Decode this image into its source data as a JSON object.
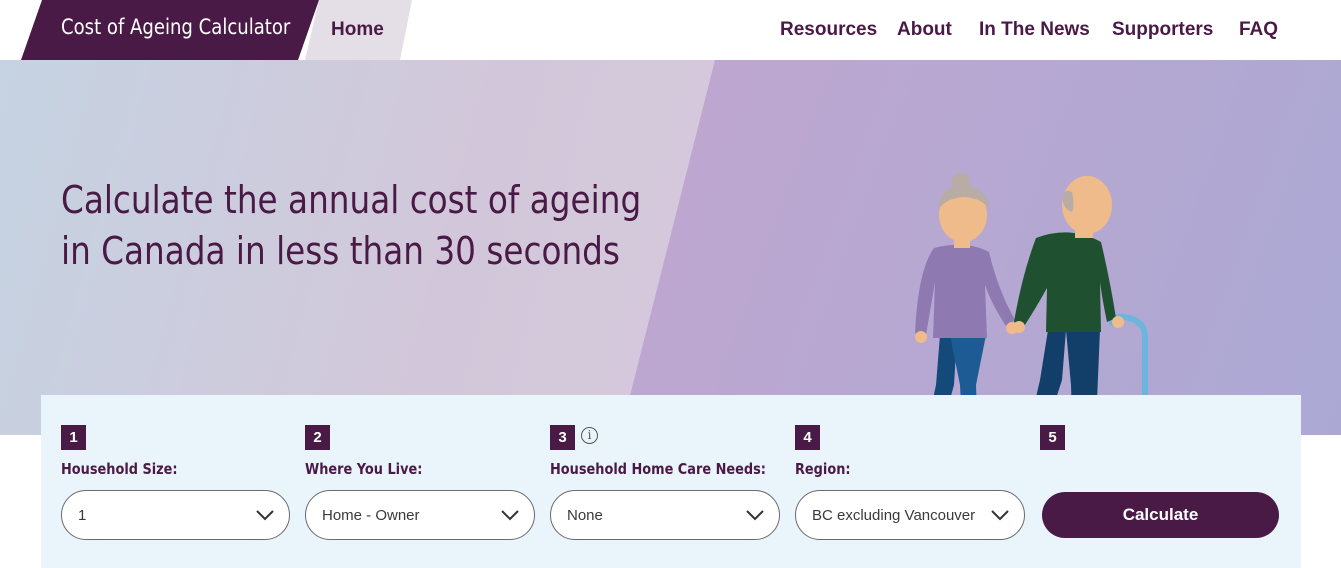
{
  "brand": {
    "title": "Cost of Ageing Calculator"
  },
  "nav": {
    "home": "Home",
    "links": [
      "Resources",
      "About",
      "In The News",
      "Supporters",
      "FAQ"
    ]
  },
  "hero": {
    "headline_line1": "Calculate the annual cost of ageing",
    "headline_line2": "in Canada in less than 30 seconds"
  },
  "form": {
    "steps": [
      {
        "number": "1",
        "label": "Household Size:",
        "value": "1"
      },
      {
        "number": "2",
        "label": "Where You Live:",
        "value": "Home - Owner"
      },
      {
        "number": "3",
        "label": "Household Home Care Needs:",
        "value": "None",
        "info_icon": "info-icon"
      },
      {
        "number": "4",
        "label": "Region:",
        "value": "BC excluding Vancouver"
      },
      {
        "number": "5"
      }
    ],
    "calculate_label": "Calculate"
  },
  "colors": {
    "brand": "#4a1a47",
    "panel": "#eaf4fb"
  }
}
